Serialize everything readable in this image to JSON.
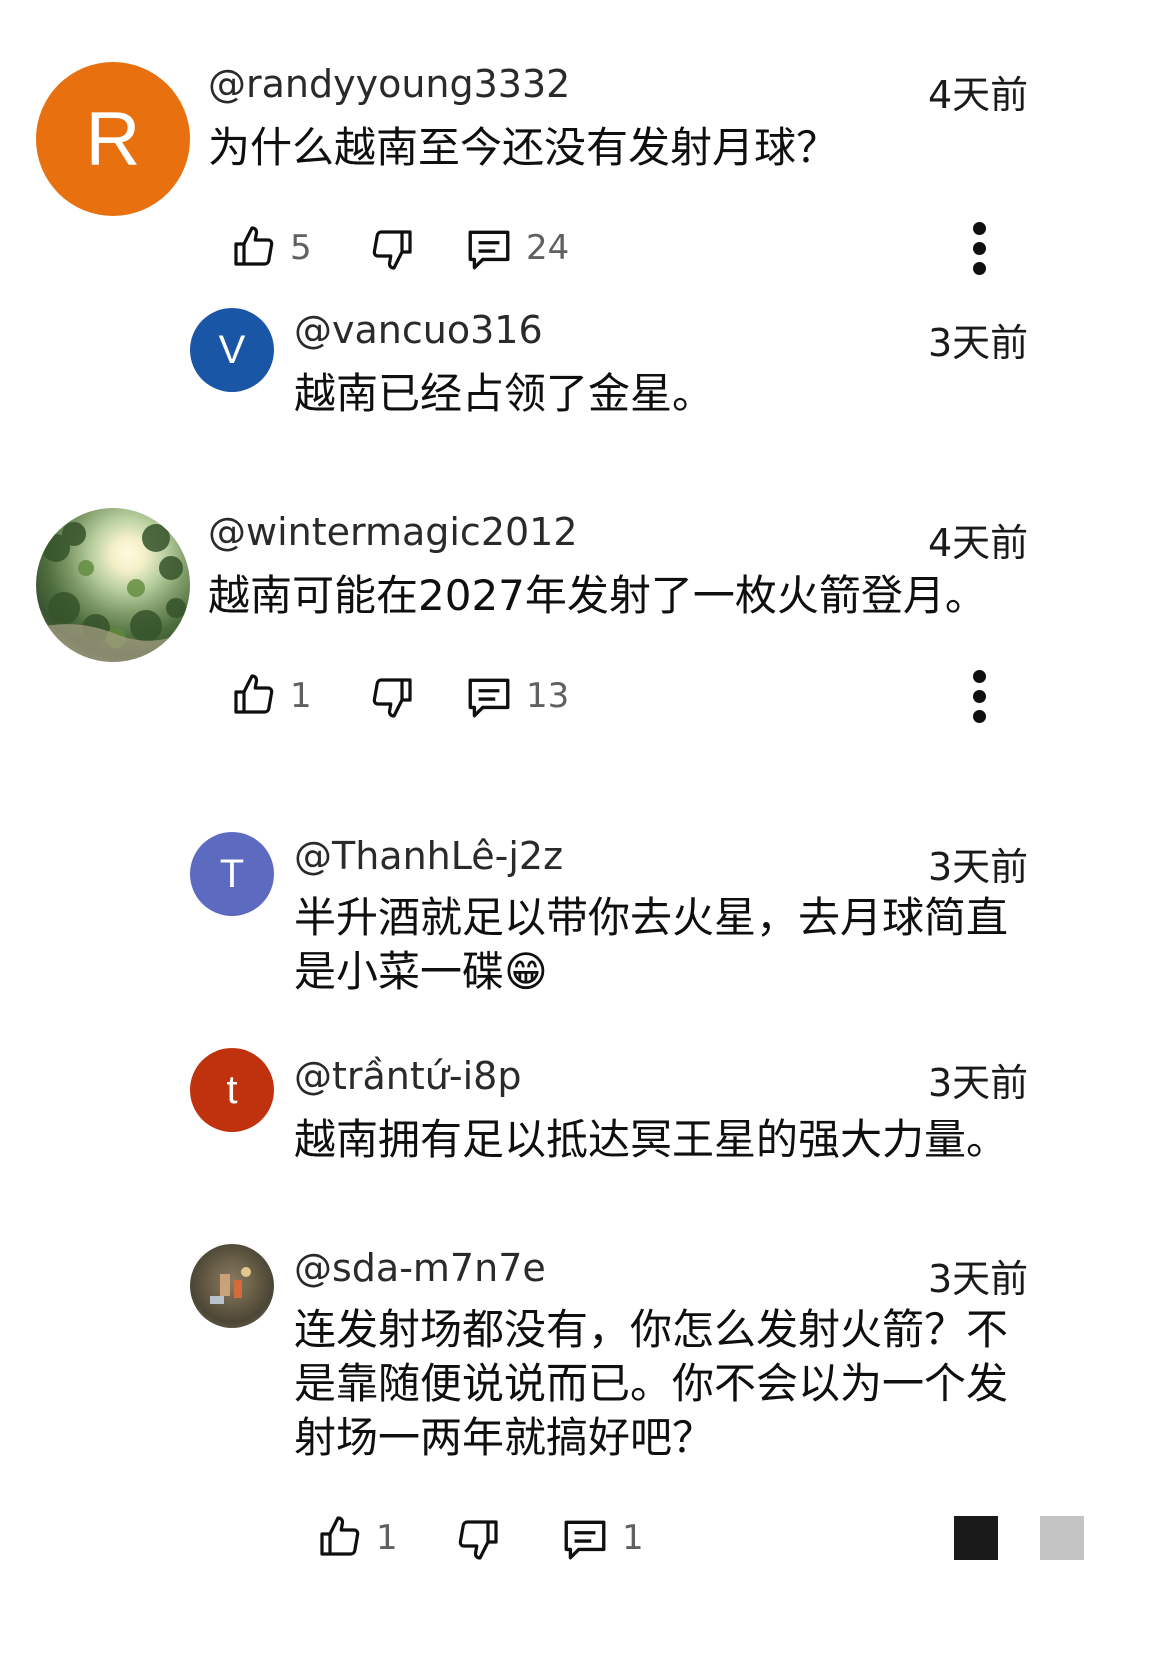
{
  "comments": [
    {
      "handle": "@randyyoung3332",
      "time": "4天前",
      "avatar_letter": "R",
      "avatar_color": "#e8700e",
      "text": "为什么越南至今还没有发射月球？",
      "likes": "5",
      "replies": "24"
    },
    {
      "handle": "@vancuo316",
      "time": "3天前",
      "avatar_letter": "V",
      "avatar_color": "#1a56a6",
      "text": "越南已经占领了金星。"
    },
    {
      "handle": "@wintermagic2012",
      "time": "4天前",
      "avatar_type": "photo",
      "text": "越南可能在2027年发射了一枚火箭登月。",
      "likes": "1",
      "replies": "13"
    },
    {
      "handle": "@ThanhLê-j2z",
      "time": "3天前",
      "avatar_letter": "T",
      "avatar_color": "#5c6bc0",
      "text_line1": "半升酒就足以带你去火星，去月球简直",
      "text_line2": "是小菜一碟",
      "emoji": "😁"
    },
    {
      "handle": "@trầntứ-i8p",
      "time": "3天前",
      "avatar_letter": "t",
      "avatar_color": "#c0320e",
      "text": "越南拥有足以抵达冥王星的强大力量。"
    },
    {
      "handle": "@sda-m7n7e",
      "time": "3天前",
      "avatar_type": "photo",
      "text_line1": "连发射场都没有，你怎么发射火箭？不",
      "text_line2": "是靠随便说说而已。你不会以为一个发",
      "text_line3": "射场一两年就搞好吧？",
      "likes": "1",
      "replies": "1"
    }
  ],
  "icons": {
    "like": "thumbs-up-icon",
    "dislike": "thumbs-down-icon",
    "reply": "reply-icon",
    "more": "more-vert-icon"
  }
}
